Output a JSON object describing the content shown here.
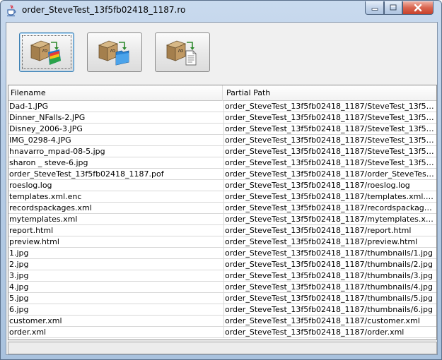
{
  "window": {
    "title": "order_SteveTest_13f5fb02418_1187.ro",
    "app_icon": "java-cup-icon"
  },
  "toolbar": {
    "buttons": [
      {
        "icon": "extract-to-folder-icon",
        "focused": true
      },
      {
        "icon": "extract-to-blue-folder-icon",
        "focused": false
      },
      {
        "icon": "extract-to-document-icon",
        "focused": false
      }
    ]
  },
  "table": {
    "columns": [
      "Filename",
      "Partial Path"
    ],
    "rows": [
      [
        "Dad-1.JPG",
        "order_SteveTest_13f5fb02418_1187/SteveTest_13f5fb024..."
      ],
      [
        "Dinner_NFalls-2.JPG",
        "order_SteveTest_13f5fb02418_1187/SteveTest_13f5fb024..."
      ],
      [
        "Disney_2006-3.JPG",
        "order_SteveTest_13f5fb02418_1187/SteveTest_13f5fb024..."
      ],
      [
        "IMG_0298-4.JPG",
        "order_SteveTest_13f5fb02418_1187/SteveTest_13f5fb024..."
      ],
      [
        "hnavarro_mpad-08-5.jpg",
        "order_SteveTest_13f5fb02418_1187/SteveTest_13f5fb024..."
      ],
      [
        "sharon _ steve-6.jpg",
        "order_SteveTest_13f5fb02418_1187/SteveTest_13f5fb024..."
      ],
      [
        "order_SteveTest_13f5fb02418_1187.pof",
        "order_SteveTest_13f5fb02418_1187/order_SteveTest_13f..."
      ],
      [
        "roeslog.log",
        "order_SteveTest_13f5fb02418_1187/roeslog.log"
      ],
      [
        "templates.xml.enc",
        "order_SteveTest_13f5fb02418_1187/templates.xml.enc"
      ],
      [
        "recordspackages.xml",
        "order_SteveTest_13f5fb02418_1187/recordspackages.xml"
      ],
      [
        "mytemplates.xml",
        "order_SteveTest_13f5fb02418_1187/mytemplates.xml"
      ],
      [
        "report.html",
        "order_SteveTest_13f5fb02418_1187/report.html"
      ],
      [
        "preview.html",
        "order_SteveTest_13f5fb02418_1187/preview.html"
      ],
      [
        "1.jpg",
        "order_SteveTest_13f5fb02418_1187/thumbnails/1.jpg"
      ],
      [
        "2.jpg",
        "order_SteveTest_13f5fb02418_1187/thumbnails/2.jpg"
      ],
      [
        "3.jpg",
        "order_SteveTest_13f5fb02418_1187/thumbnails/3.jpg"
      ],
      [
        "4.jpg",
        "order_SteveTest_13f5fb02418_1187/thumbnails/4.jpg"
      ],
      [
        "5.jpg",
        "order_SteveTest_13f5fb02418_1187/thumbnails/5.jpg"
      ],
      [
        "6.jpg",
        "order_SteveTest_13f5fb02418_1187/thumbnails/6.jpg"
      ],
      [
        "customer.xml",
        "order_SteveTest_13f5fb02418_1187/customer.xml"
      ],
      [
        "order.xml",
        "order_SteveTest_13f5fb02418_1187/order.xml"
      ]
    ]
  },
  "status_bar": {
    "text": ""
  }
}
